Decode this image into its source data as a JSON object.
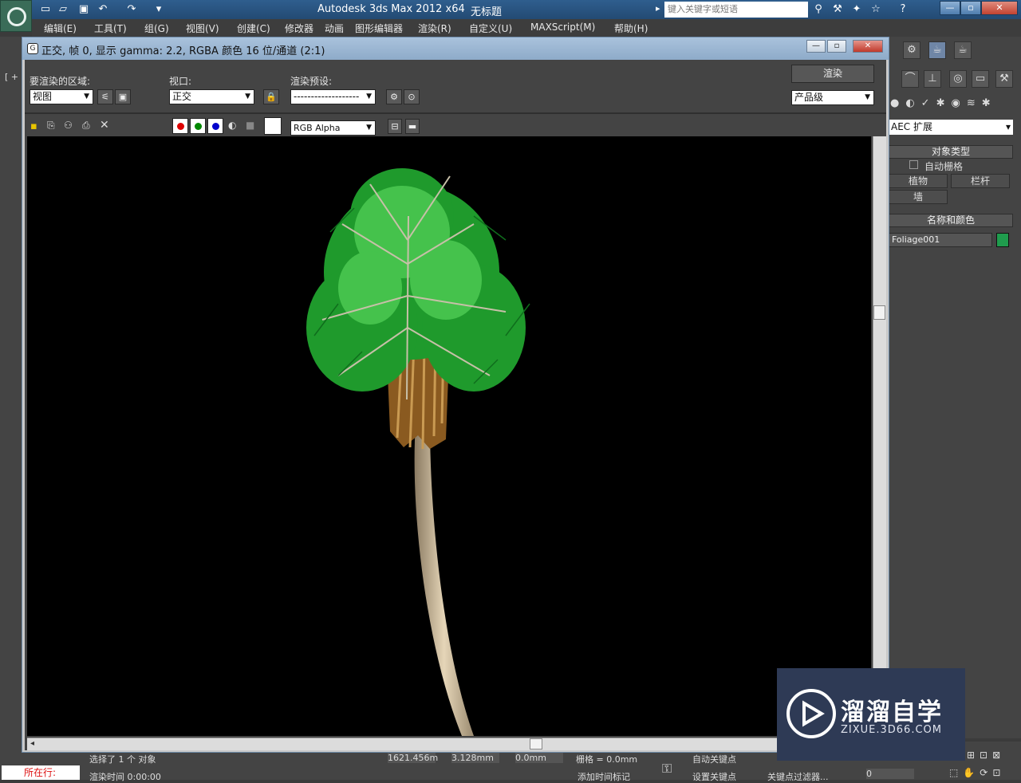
{
  "app": {
    "title": "Autodesk 3ds Max  2012 x64",
    "doc": "无标题",
    "search_placeholder": "键入关键字或短语"
  },
  "menu": [
    "编辑(E)",
    "工具(T)",
    "组(G)",
    "视图(V)",
    "创建(C)",
    "修改器",
    "动画",
    "图形编辑器",
    "渲染(R)",
    "自定义(U)",
    "MAXScript(M)",
    "帮助(H)"
  ],
  "render_frame": {
    "title": "正交, 帧 0, 显示 gamma: 2.2, RGBA 颜色 16 位/通道 (2:1)",
    "area_label": "要渲染的区域:",
    "area_value": "视图",
    "viewport_label": "视口:",
    "viewport_value": "正交",
    "preset_label": "渲染预设:",
    "preset_value": "-------------------",
    "render_button": "渲染",
    "quality_value": "产品级",
    "channel_value": "RGB Alpha"
  },
  "right_panel": {
    "category": "AEC 扩展",
    "object_type_header": "对象类型",
    "autogrid_label": "自动栅格",
    "buttons": [
      "植物",
      "栏杆",
      "墙"
    ],
    "name_color_header": "名称和颜色",
    "object_name": "Foliage001",
    "object_color": "#1f9c4d"
  },
  "status": {
    "selection": "选择了 1 个 对象",
    "render_time": "渲染时间  0:00:00",
    "x_value": "1621.456m",
    "y_value": "3.128mm",
    "z_value": "0.0mm",
    "grid": "栅格 = 0.0mm",
    "auto_key": "自动关键点",
    "set_key": "设置关键点",
    "add_time_tag": "添加时间标记",
    "key_filters": "关键点过滤器...",
    "frame": "0",
    "running": "所在行:"
  },
  "watermark": {
    "main": "溜溜自学",
    "sub": "ZIXUE.3D66.COM"
  }
}
